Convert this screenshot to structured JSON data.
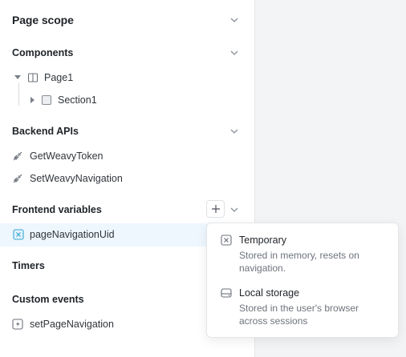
{
  "page_scope": {
    "title": "Page scope"
  },
  "components": {
    "title": "Components",
    "tree": [
      {
        "label": "Page1"
      },
      {
        "label": "Section1"
      }
    ]
  },
  "backend_apis": {
    "title": "Backend APIs",
    "items": [
      {
        "label": "GetWeavyToken"
      },
      {
        "label": "SetWeavyNavigation"
      }
    ]
  },
  "frontend_variables": {
    "title": "Frontend variables",
    "items": [
      {
        "label": "pageNavigationUid"
      }
    ]
  },
  "timers": {
    "title": "Timers"
  },
  "custom_events": {
    "title": "Custom events",
    "items": [
      {
        "label": "setPageNavigation"
      }
    ]
  },
  "variable_type_menu": {
    "options": [
      {
        "title": "Temporary",
        "description": "Stored in memory, resets on navigation."
      },
      {
        "title": "Local storage",
        "description": "Stored in the user's browser across sessions"
      }
    ]
  },
  "colors": {
    "accent": "#3aa5d8",
    "highlight": "#eef7fd",
    "panel_bg": "#ffffff",
    "canvas_bg": "#f3f4f5"
  }
}
